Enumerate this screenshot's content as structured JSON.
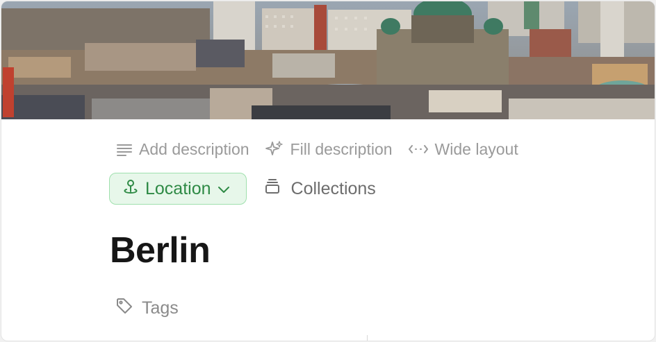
{
  "cover": {
    "alt": "Berlin city skyline cover image"
  },
  "toolbar": {
    "add_description_label": "Add description",
    "fill_description_label": "Fill description",
    "wide_layout_label": "Wide layout"
  },
  "properties": {
    "location_label": "Location",
    "collections_label": "Collections"
  },
  "page": {
    "title": "Berlin"
  },
  "tags": {
    "label": "Tags"
  },
  "colors": {
    "location_text": "#2e8a45",
    "location_bg": "#e7f7ea",
    "location_border": "#9fe0ad",
    "muted_text": "#9a9a9a",
    "title_text": "#161616"
  },
  "icons": {
    "add_description": "lines-icon",
    "fill_description": "sparkle-icon",
    "wide_layout": "arrows-horizontal-icon",
    "location": "map-pin-icon",
    "location_dropdown": "chevron-down-icon",
    "collections": "stack-icon",
    "tags": "tag-icon"
  }
}
